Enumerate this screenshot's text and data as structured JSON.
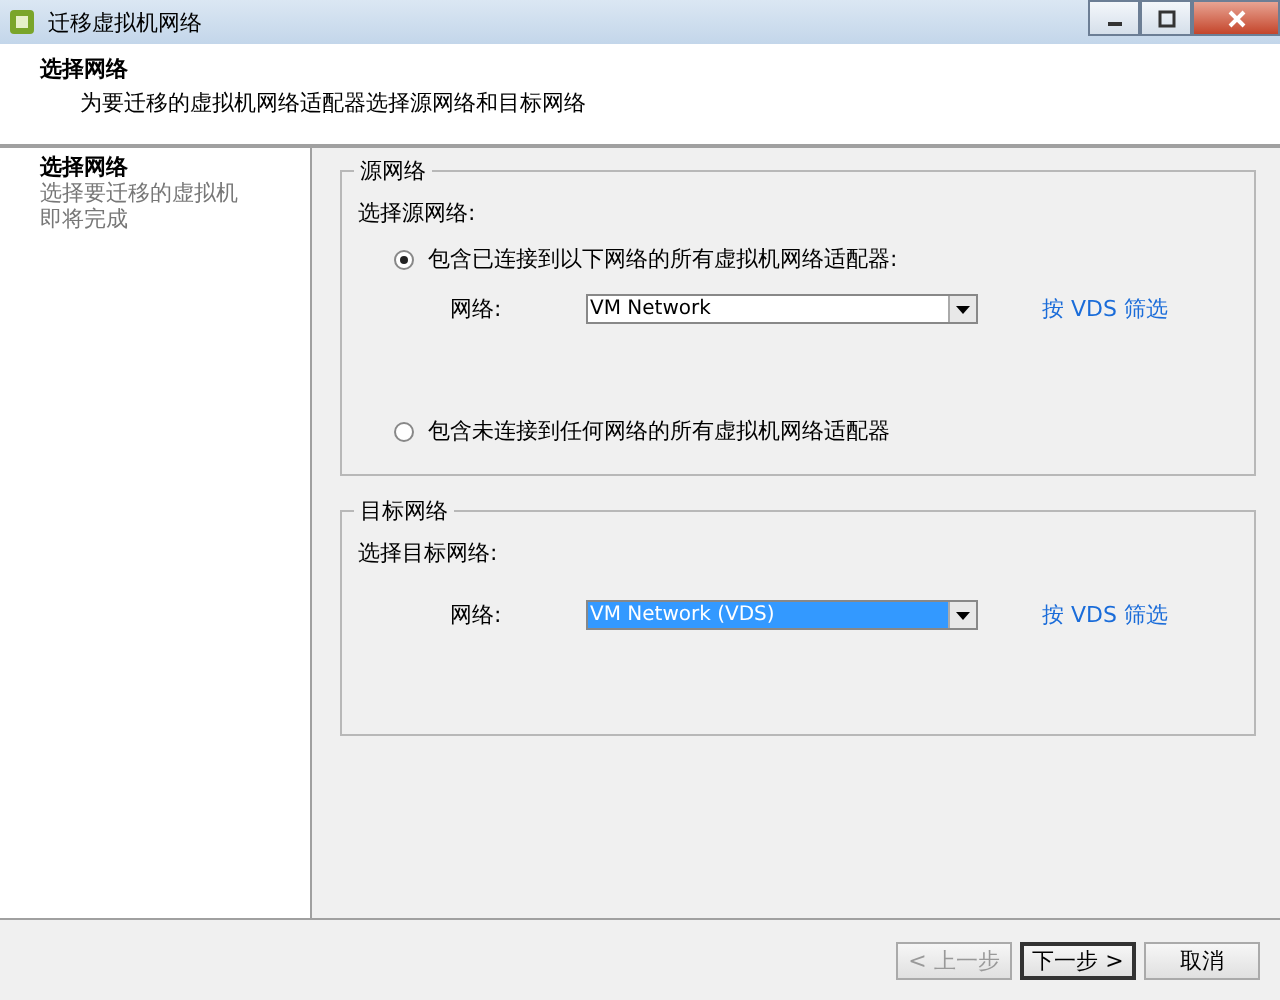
{
  "window": {
    "title": "迁移虚拟机网络"
  },
  "header": {
    "title": "选择网络",
    "subtitle": "为要迁移的虚拟机网络适配器选择源网络和目标网络"
  },
  "steps": [
    {
      "label": "选择网络",
      "selected": true
    },
    {
      "label": "选择要迁移的虚拟机",
      "selected": false
    },
    {
      "label": "即将完成",
      "selected": false
    }
  ],
  "source_group": {
    "legend": "源网络",
    "prompt": "选择源网络:",
    "options": [
      {
        "label": "包含已连接到以下网络的所有虚拟机网络适配器:",
        "selected": true
      },
      {
        "label": "包含未连接到任何网络的所有虚拟机网络适配器",
        "selected": false
      }
    ],
    "network_label": "网络:",
    "network_value": "VM Network",
    "focused": false,
    "filter_link": "按 VDS 筛选"
  },
  "target_group": {
    "legend": "目标网络",
    "prompt": "选择目标网络:",
    "network_label": "网络:",
    "network_value": "VM Network (VDS)",
    "focused": true,
    "filter_link": "按 VDS 筛选"
  },
  "buttons": [
    {
      "label": "< 上一步",
      "disabled": true,
      "default": false
    },
    {
      "label": "下一步 >",
      "disabled": false,
      "default": true
    },
    {
      "label": "取消",
      "disabled": false,
      "default": false
    }
  ]
}
